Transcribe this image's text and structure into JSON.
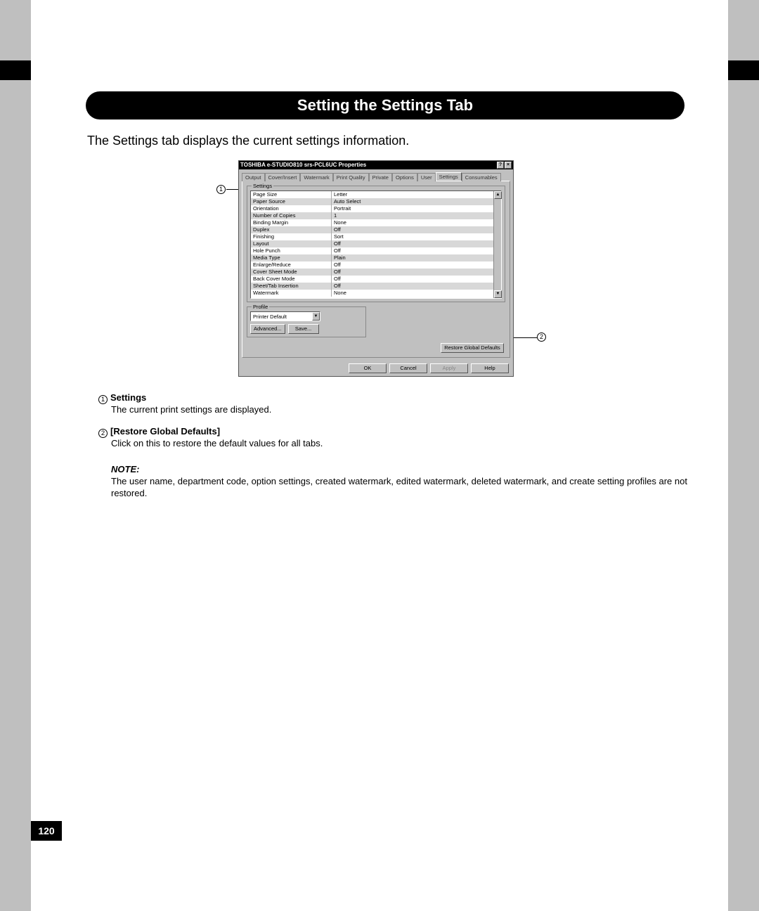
{
  "page": {
    "section_title": "Setting the Settings Tab",
    "intro": "The Settings tab displays the current settings information.",
    "page_number": "120"
  },
  "dialog": {
    "title": "TOSHIBA e-STUDIO810 srs-PCL6UC Properties",
    "help_icon": "?",
    "close_icon": "×",
    "tabs": [
      "Output",
      "Cover/Insert",
      "Watermark",
      "Print Quality",
      "Private",
      "Options",
      "User",
      "Settings",
      "Consumables"
    ],
    "active_tab_index": 7,
    "fieldset_settings_label": "Settings",
    "settings_rows": [
      {
        "name": "Page Size",
        "value": "Letter"
      },
      {
        "name": "Paper Source",
        "value": "Auto Select"
      },
      {
        "name": "Orientation",
        "value": "Portrait"
      },
      {
        "name": "Number of Copies",
        "value": "1"
      },
      {
        "name": "Binding Margin",
        "value": "None"
      },
      {
        "name": "Duplex",
        "value": "Off"
      },
      {
        "name": "Finishing",
        "value": "Sort"
      },
      {
        "name": "Layout",
        "value": "Off"
      },
      {
        "name": "Hole Punch",
        "value": "Off"
      },
      {
        "name": "Media Type",
        "value": "Plain"
      },
      {
        "name": "Enlarge/Reduce",
        "value": "Off"
      },
      {
        "name": "Cover Sheet Mode",
        "value": "Off"
      },
      {
        "name": "Back Cover Mode",
        "value": "Off"
      },
      {
        "name": "Sheet/Tab Insertion",
        "value": "Off"
      },
      {
        "name": "Watermark",
        "value": "None"
      }
    ],
    "fieldset_profile_label": "Profile",
    "profile_selected": "Printer Default",
    "btn_advanced": "Advanced...",
    "btn_save": "Save...",
    "btn_restore_defaults": "Restore Global Defaults",
    "btn_ok": "OK",
    "btn_cancel": "Cancel",
    "btn_apply": "Apply",
    "btn_help": "Help"
  },
  "callouts": {
    "c1": "1",
    "c2": "2"
  },
  "descriptions": {
    "d1_title": "Settings",
    "d1_body": "The current print settings are displayed.",
    "d2_title": "[Restore Global Defaults]",
    "d2_body": "Click on this to restore the default values for all tabs.",
    "note_label": "NOTE:",
    "note_body": "The user name, department code, option settings, created watermark, edited watermark, deleted watermark, and create setting profiles are not restored."
  }
}
